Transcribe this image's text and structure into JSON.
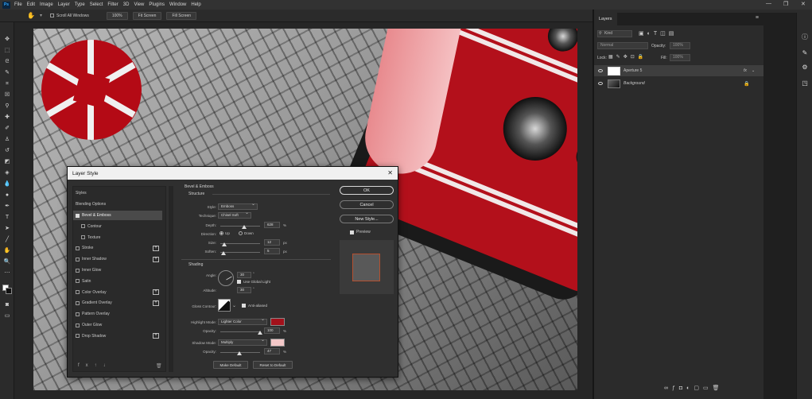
{
  "menu": {
    "app_logo": "Ps",
    "items": [
      "File",
      "Edit",
      "Image",
      "Layer",
      "Type",
      "Select",
      "Filter",
      "3D",
      "View",
      "Plugins",
      "Window",
      "Help"
    ],
    "window_controls": [
      "—",
      "❐",
      "✕"
    ]
  },
  "options_bar": {
    "scroll_all_windows": "Scroll All Windows",
    "zoom": "100%",
    "fit_screen": "Fit Screen",
    "fill_screen": "Fill Screen"
  },
  "layers_panel": {
    "tab": "Layers",
    "kind_filter": "Kind",
    "blend_mode": "Normal",
    "opacity_label": "Opacity:",
    "opacity_value": "100%",
    "lock_label": "Lock:",
    "fill_label": "Fill:",
    "fill_value": "100%",
    "layers": [
      {
        "name": "Aperture 5",
        "fx": "fx"
      },
      {
        "name": "Background"
      }
    ]
  },
  "dialog": {
    "title": "Layer Style",
    "close": "✕",
    "styles_header": "Styles",
    "blending_options": "Blending Options",
    "items": [
      {
        "label": "Bevel & Emboss",
        "checked": true,
        "selected": true,
        "plus": false
      },
      {
        "label": "Contour",
        "checked": false,
        "indent": true,
        "plus": false
      },
      {
        "label": "Texture",
        "checked": false,
        "indent": true,
        "plus": false
      },
      {
        "label": "Stroke",
        "checked": false,
        "plus": true
      },
      {
        "label": "Inner Shadow",
        "checked": false,
        "plus": true
      },
      {
        "label": "Inner Glow",
        "checked": false,
        "plus": false
      },
      {
        "label": "Satin",
        "checked": false,
        "plus": false
      },
      {
        "label": "Color Overlay",
        "checked": false,
        "plus": true
      },
      {
        "label": "Gradient Overlay",
        "checked": false,
        "plus": true
      },
      {
        "label": "Pattern Overlay",
        "checked": false,
        "plus": false
      },
      {
        "label": "Outer Glow",
        "checked": false,
        "plus": false
      },
      {
        "label": "Drop Shadow",
        "checked": false,
        "plus": true
      }
    ],
    "footer_icons": [
      "fx",
      "↑",
      "↓",
      "🗑"
    ],
    "bevel": {
      "section": "Bevel & Emboss",
      "structure": "Structure",
      "style_label": "Style:",
      "style_value": "Emboss",
      "technique_label": "Technique:",
      "technique_value": "Chisel Soft",
      "depth_label": "Depth:",
      "depth_value": "628",
      "depth_unit": "%",
      "depth_pct": 0.6,
      "direction_label": "Direction:",
      "dir_up": "Up",
      "dir_down": "Down",
      "size_label": "Size:",
      "size_value": "12",
      "size_unit": "px",
      "size_pct": 0.1,
      "soften_label": "Soften:",
      "soften_value": "5",
      "soften_unit": "px",
      "soften_pct": 0.08
    },
    "shading": {
      "section": "Shading",
      "angle_label": "Angle:",
      "angle_value": "30",
      "degree": "°",
      "global_light": "Use Global Light",
      "altitude_label": "Altitude:",
      "altitude_value": "30",
      "gloss_label": "Gloss Contour:",
      "anti_aliased": "Anti-aliased",
      "highlight_label": "Highlight Mode:",
      "highlight_value": "Lighter Color",
      "highlight_color": "#a3111b",
      "hl_opacity_label": "Opacity:",
      "hl_opacity_value": "100",
      "hl_opacity_pct": 1.0,
      "pct": "%",
      "shadow_label": "Shadow Mode:",
      "shadow_value": "Multiply",
      "shadow_color": "#f4c8c8",
      "sh_opacity_label": "Opacity:",
      "sh_opacity_value": "47",
      "sh_opacity_pct": 0.47
    },
    "make_default": "Make Default",
    "reset_default": "Reset to Default",
    "ok": "OK",
    "cancel": "Cancel",
    "new_style": "New Style...",
    "preview": "Preview"
  }
}
